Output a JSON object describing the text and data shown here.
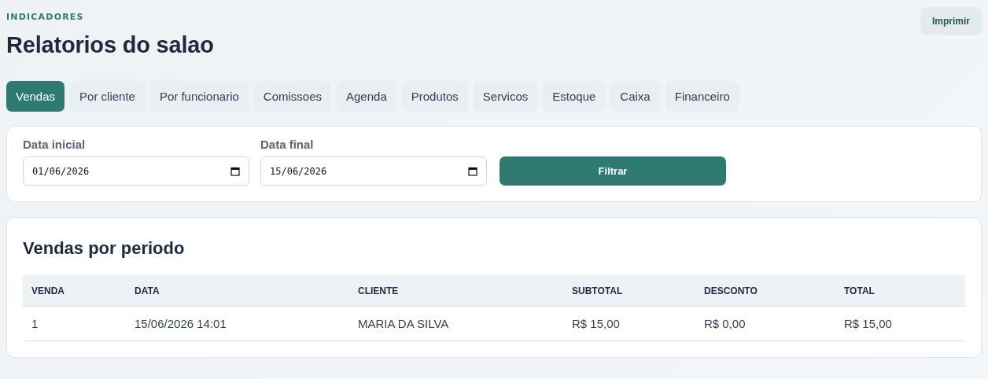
{
  "header": {
    "eyebrow": "INDICADORES",
    "title": "Relatorios do salao",
    "print_button": "Imprimir"
  },
  "tabs": [
    {
      "label": "Vendas",
      "selected": true
    },
    {
      "label": "Por cliente",
      "selected": false
    },
    {
      "label": "Por funcionario",
      "selected": false
    },
    {
      "label": "Comissoes",
      "selected": false
    },
    {
      "label": "Agenda",
      "selected": false
    },
    {
      "label": "Produtos",
      "selected": false
    },
    {
      "label": "Servicos",
      "selected": false
    },
    {
      "label": "Estoque",
      "selected": false
    },
    {
      "label": "Caixa",
      "selected": false
    },
    {
      "label": "Financeiro",
      "selected": false
    }
  ],
  "filters": {
    "fields": [
      {
        "label": "Data inicial",
        "value": "01/06/2026"
      },
      {
        "label": "Data final",
        "value": "15/06/2026"
      }
    ],
    "button": "Filtrar"
  },
  "table": {
    "title": "Vendas por periodo",
    "columns": [
      "VENDA",
      "DATA",
      "CLIENTE",
      "SUBTOTAL",
      "DESCONTO",
      "TOTAL"
    ],
    "rows": [
      [
        "1",
        "15/06/2026 14:01",
        "MARIA DA SILVA",
        "R$ 15,00",
        "R$ 0,00",
        "R$ 15,00"
      ]
    ]
  }
}
